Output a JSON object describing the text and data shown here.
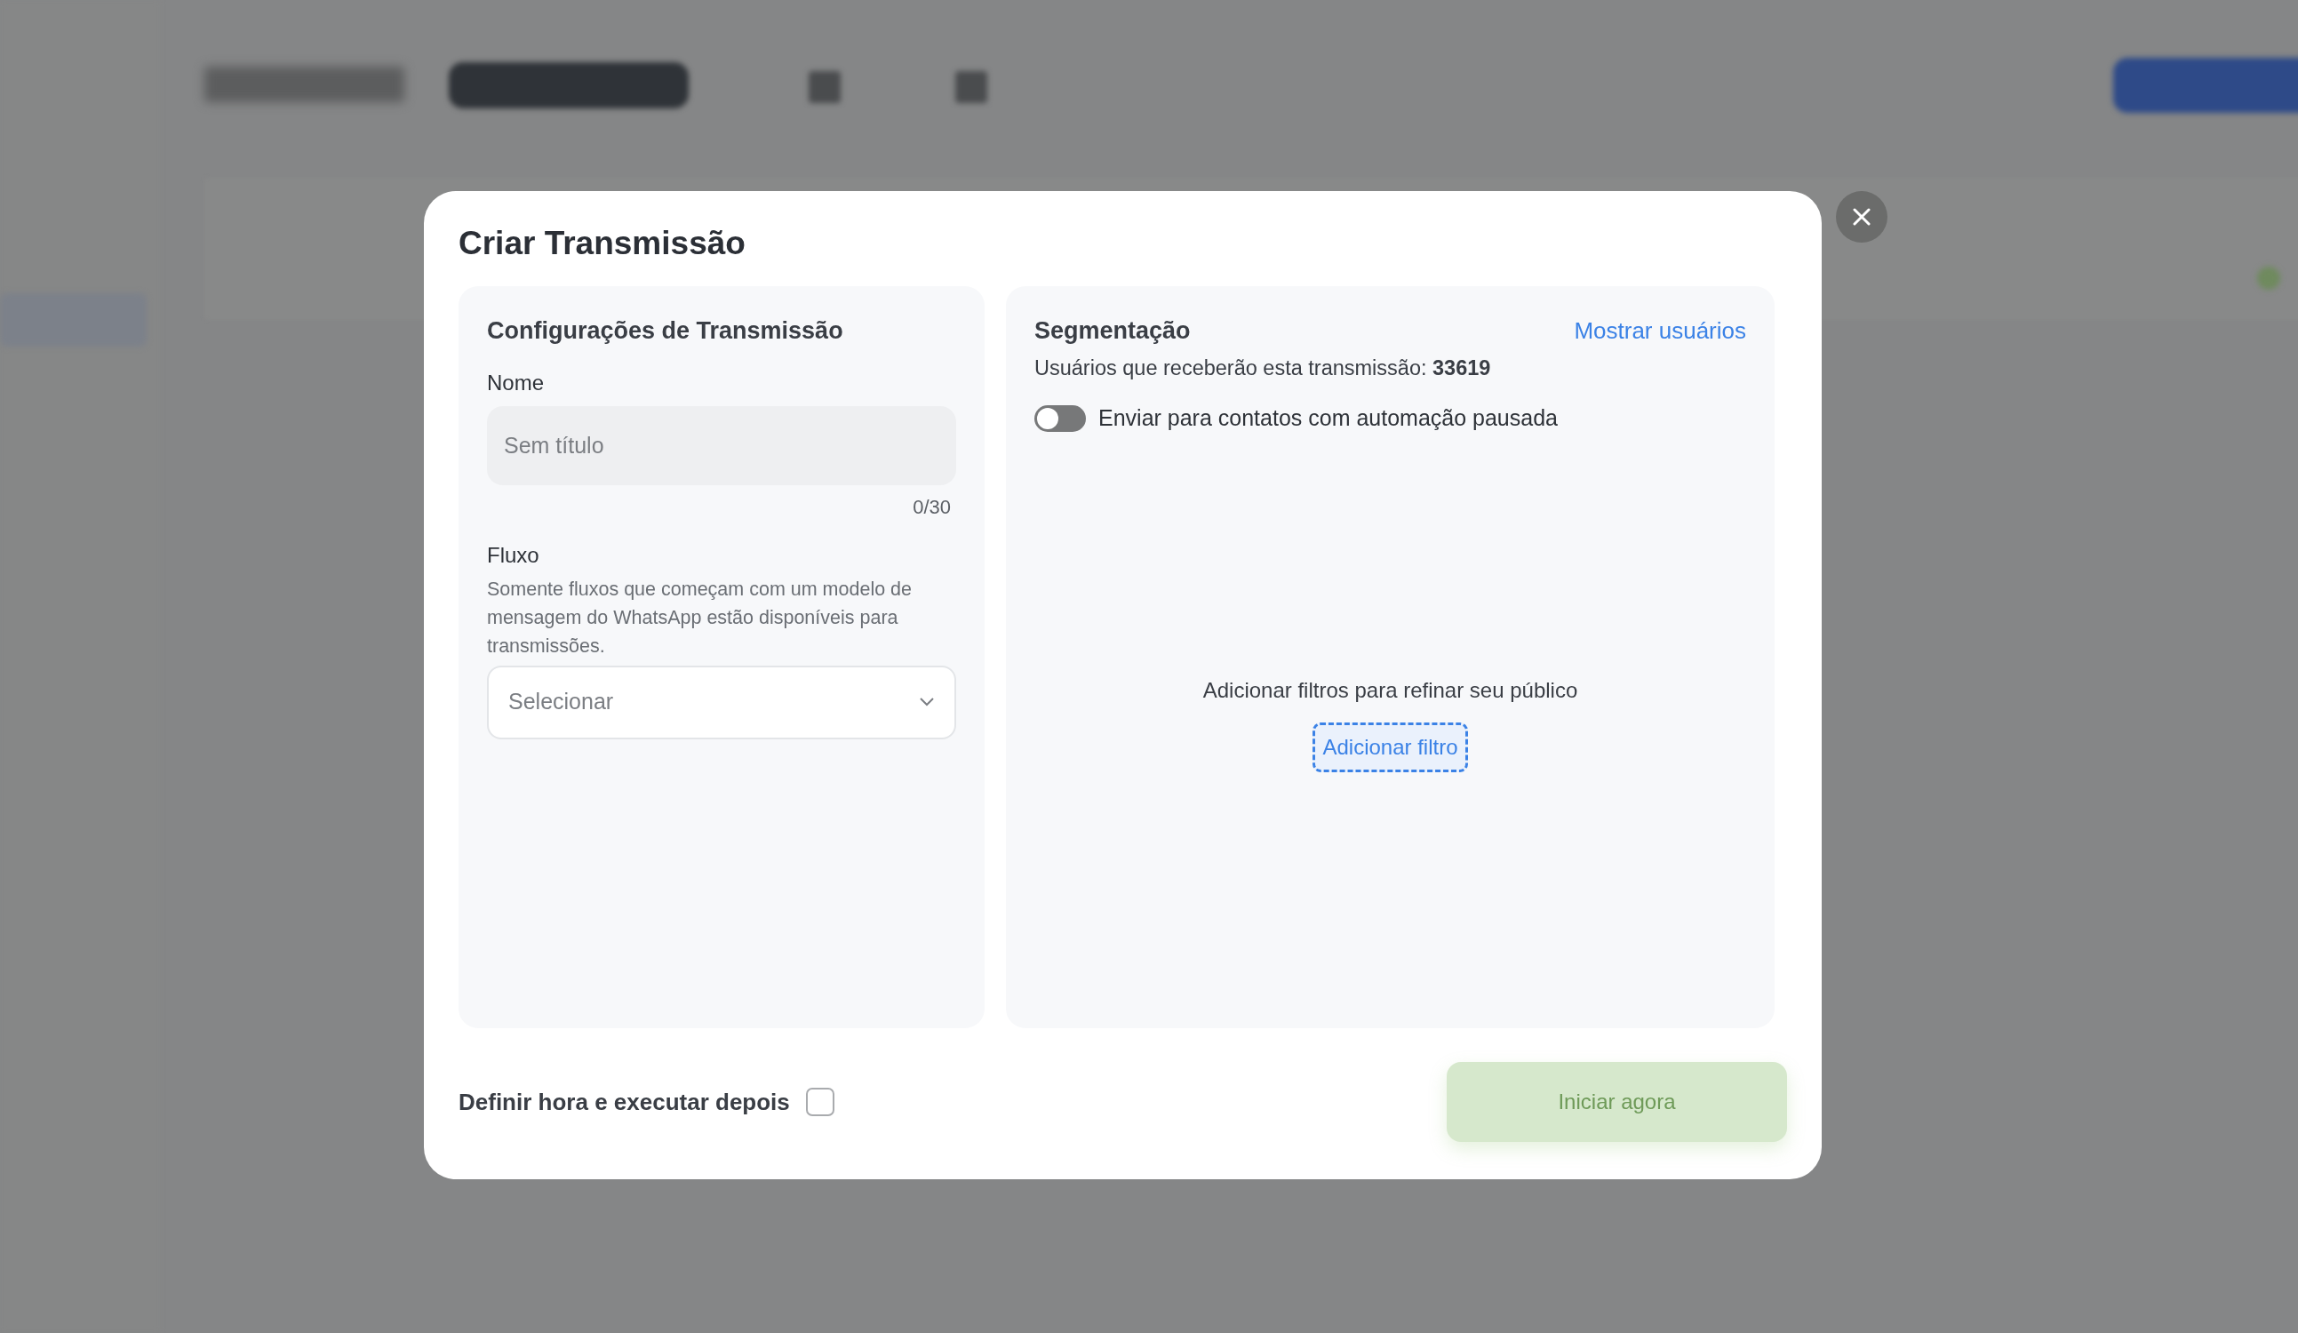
{
  "dialog": {
    "title": "Criar Transmissão",
    "settings": {
      "heading": "Configurações de Transmissão",
      "name_label": "Nome",
      "name_field": {
        "placeholder": "Sem título"
      },
      "counter": "0/30",
      "flow_label": "Fluxo",
      "flow_hint": "Somente fluxos que começam com um modelo de mensagem do WhatsApp estão disponíveis para transmissões.",
      "flow_select": {
        "placeholder": "Selecionar"
      }
    },
    "segmentation": {
      "heading": "Segmentação",
      "link": "Mostrar usuários",
      "recipients": "Usuários que receberão esta transmissão: **33619**",
      "toggle": {
        "label": "Enviar para contatos com automação pausada",
        "on": false
      },
      "empty_text": "Adicionar filtros para refinar seu público",
      "add_filter": "Adicionar filtro"
    },
    "schedule": {
      "label": "Definir hora e executar depois",
      "checked": false
    },
    "start_button": {
      "label": "Iniciar agora",
      "disabled": true
    }
  }
}
